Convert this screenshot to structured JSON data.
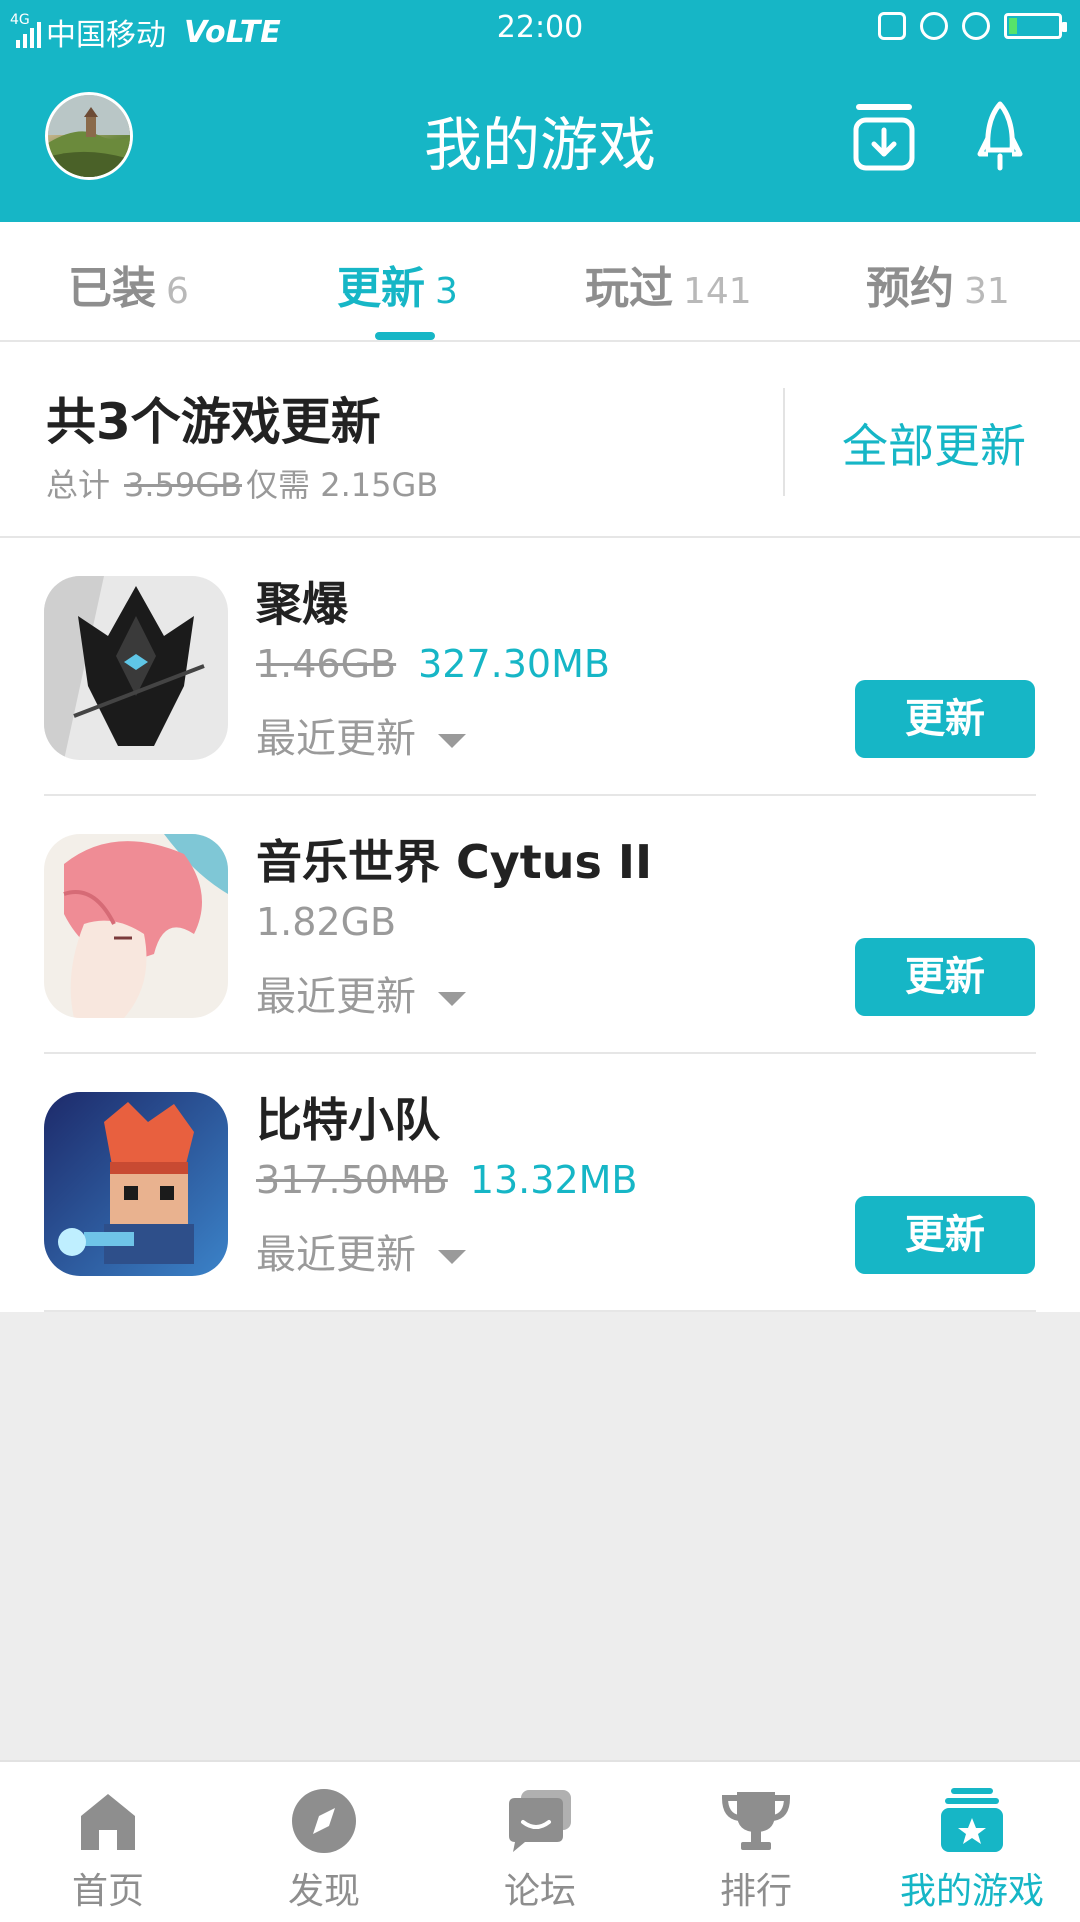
{
  "status_bar": {
    "network": "4G",
    "carrier": "中国移动",
    "volte": "VoLTE",
    "time": "22:00"
  },
  "header": {
    "title": "我的游戏"
  },
  "tabs": [
    {
      "label": "已装",
      "count": "6"
    },
    {
      "label": "更新",
      "count": "3"
    },
    {
      "label": "玩过",
      "count": "141"
    },
    {
      "label": "预约",
      "count": "31"
    }
  ],
  "summary": {
    "title": "共3个游戏更新",
    "total_label": "总计",
    "original_size": "3.59GB",
    "need_label": "仅需",
    "need_size": "2.15GB",
    "update_all_label": "全部更新"
  },
  "games": [
    {
      "name": "聚爆",
      "old_size": "1.46GB",
      "new_size": "327.30MB",
      "recent_label": "最近更新",
      "button_label": "更新"
    },
    {
      "name": "音乐世界 Cytus II",
      "old_size": "",
      "new_size": "1.82GB",
      "recent_label": "最近更新",
      "button_label": "更新"
    },
    {
      "name": "比特小队",
      "old_size": "317.50MB",
      "new_size": "13.32MB",
      "recent_label": "最近更新",
      "button_label": "更新"
    }
  ],
  "bottom_nav": [
    {
      "label": "首页",
      "icon": "home-icon"
    },
    {
      "label": "发现",
      "icon": "compass-icon"
    },
    {
      "label": "论坛",
      "icon": "forum-icon"
    },
    {
      "label": "排行",
      "icon": "trophy-icon"
    },
    {
      "label": "我的游戏",
      "icon": "my-games-icon"
    }
  ],
  "colors": {
    "accent": "#16b6c6",
    "muted": "#9a9a9a"
  }
}
